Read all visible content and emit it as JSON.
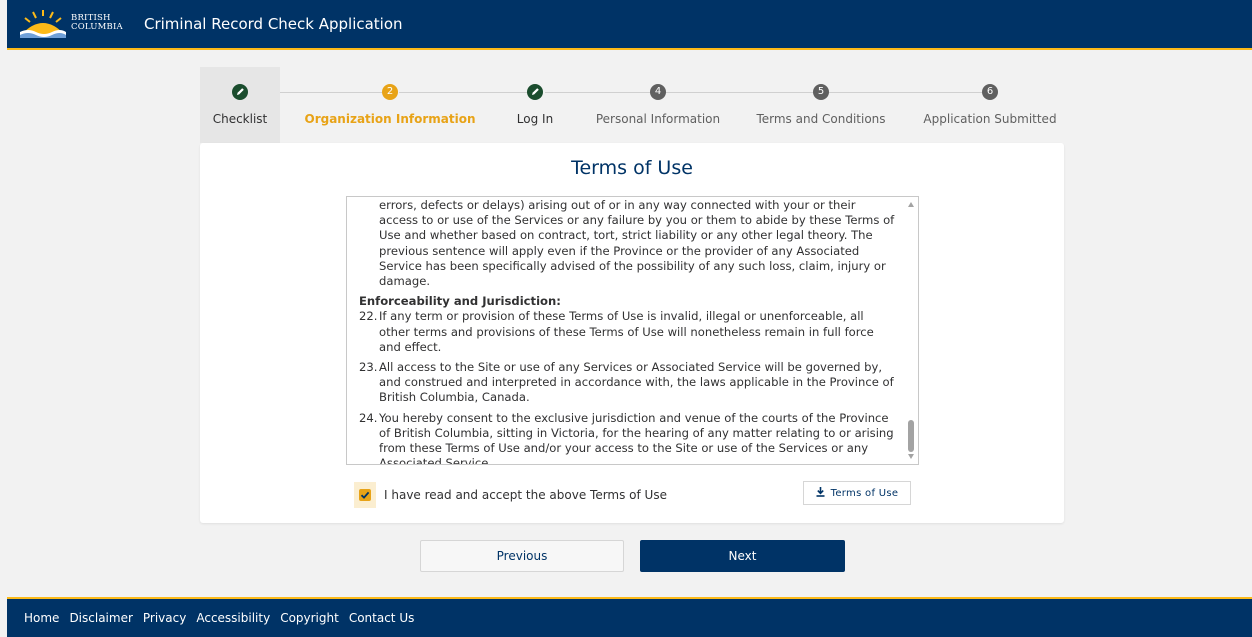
{
  "header": {
    "logo_line1": "BRITISH",
    "logo_line2": "COLUMBIA",
    "title": "Criminal Record Check Application"
  },
  "stepper": {
    "steps": [
      {
        "label": "Checklist",
        "state": "done",
        "icon": "check-icon"
      },
      {
        "label": "Organization Information",
        "state": "current",
        "number": "2"
      },
      {
        "label": "Log In",
        "state": "done",
        "icon": "check-icon"
      },
      {
        "label": "Personal Information",
        "state": "todo",
        "number": "4"
      },
      {
        "label": "Terms and Conditions",
        "state": "todo",
        "number": "5"
      },
      {
        "label": "Application Submitted",
        "state": "todo",
        "number": "6"
      }
    ]
  },
  "terms": {
    "title": "Terms of Use",
    "paragraph_tail": "errors, defects or delays) arising out of or in any way connected with your or their access to or use of the Services or any failure by you or them to abide by these Terms of Use and whether based on contract, tort, strict liability or any other legal theory. The previous sentence will apply even if the Province or the provider of any Associated Service has been specifically advised of the possibility of any such loss, claim, injury or damage.",
    "section_heading": "Enforceability and Jurisdiction:",
    "items": [
      {
        "num": "22.",
        "text": "If any term or provision of these Terms of Use is invalid, illegal or unenforceable, all other terms and provisions of these Terms of Use will nonetheless remain in full force and effect."
      },
      {
        "num": "23.",
        "text": "All access to the Site or use of any Services or Associated Service will be governed by, and construed and interpreted in accordance with, the laws applicable in the Province of British Columbia, Canada."
      },
      {
        "num": "24.",
        "text": "You hereby consent to the exclusive jurisdiction and venue of the courts of the Province of British Columbia, sitting in Victoria, for the hearing of any matter relating to or arising from these Terms of Use and/or your access to the Site or use of the Services or any Associated Service."
      }
    ],
    "accept_label": "I have read and accept the above Terms of Use",
    "accepted": true,
    "download_label": "Terms of Use"
  },
  "nav": {
    "previous_label": "Previous",
    "next_label": "Next"
  },
  "footer": {
    "links": [
      "Home",
      "Disclaimer",
      "Privacy",
      "Accessibility",
      "Copyright",
      "Contact Us"
    ]
  },
  "colors": {
    "primary": "#003366",
    "accent": "#fcba19",
    "step_current": "#e8a317",
    "step_done": "#1b4d2e"
  }
}
